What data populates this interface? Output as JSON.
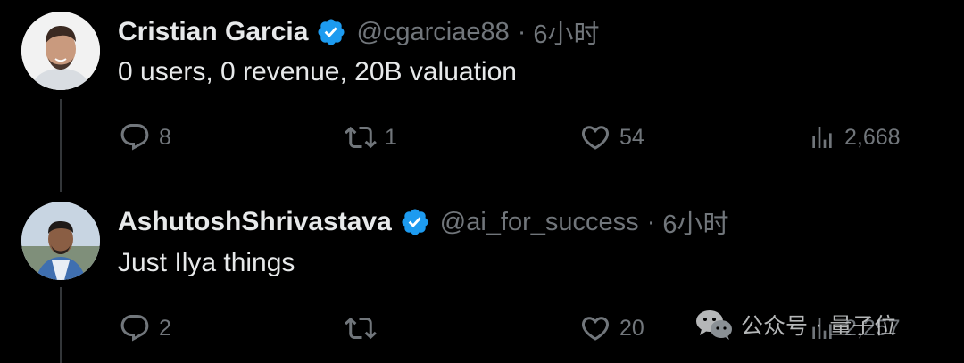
{
  "tweets": [
    {
      "name": "Cristian Garcia",
      "handle": "@cgarciae88",
      "separator": "·",
      "time": "6小时",
      "text": "0 users, 0 revenue, 20B valuation",
      "replies": "8",
      "retweets": "1",
      "likes": "54",
      "views": "2,668"
    },
    {
      "name": "AshutoshShrivastava",
      "handle": "@ai_for_success",
      "separator": "·",
      "time": "6小时",
      "text": "Just Ilya things",
      "replies": "2",
      "retweets": "",
      "likes": "20",
      "views": "2,257"
    }
  ],
  "watermark": {
    "brand": "公众号",
    "separator": "·",
    "account": "量子位"
  },
  "colors": {
    "background": "#000000",
    "text_primary": "#e7e9ea",
    "text_secondary": "#71767b",
    "verified_blue": "#1d9bf0"
  }
}
